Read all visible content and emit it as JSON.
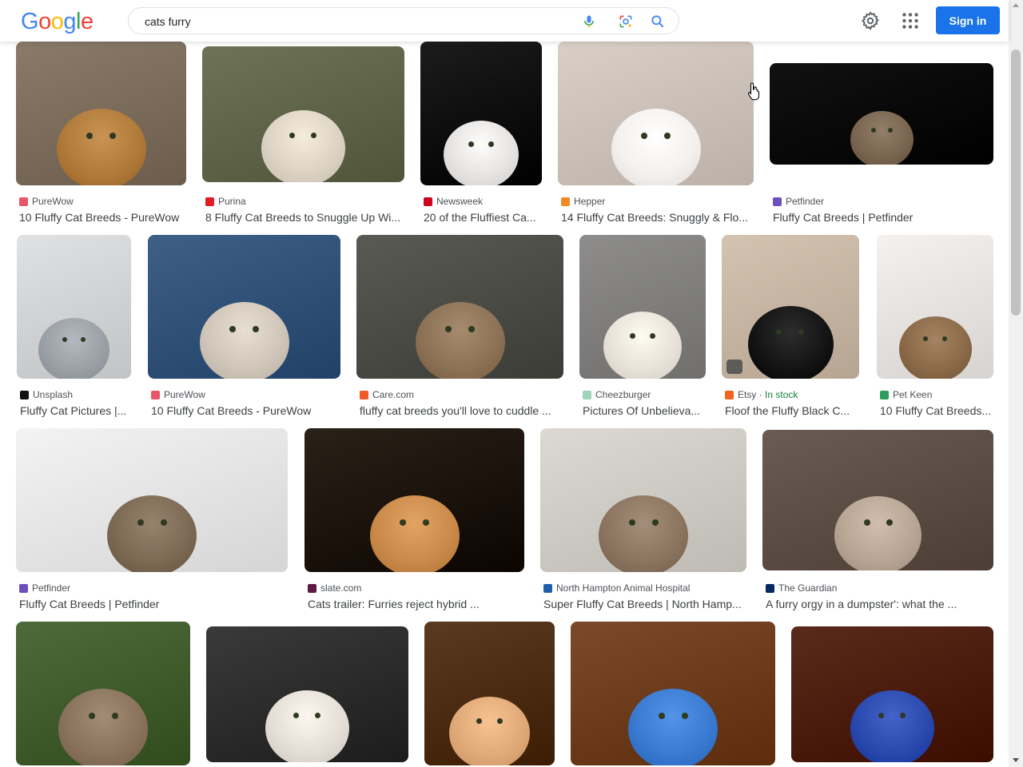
{
  "header": {
    "logo_letters": [
      {
        "ch": "G",
        "color": "#4285f4"
      },
      {
        "ch": "o",
        "color": "#ea4335"
      },
      {
        "ch": "o",
        "color": "#fbbc05"
      },
      {
        "ch": "g",
        "color": "#4285f4"
      },
      {
        "ch": "l",
        "color": "#34a853"
      },
      {
        "ch": "e",
        "color": "#ea4335"
      }
    ],
    "search_value": "cats furry",
    "signin_label": "Sign in",
    "icons": [
      "mic-icon",
      "lens-icon",
      "search-icon",
      "gear-icon",
      "apps-grid-icon"
    ]
  },
  "results": [
    {
      "source": "PureWow",
      "title": "10 Fluffy Cat Breeds - PureWow",
      "fav": "#e8566a",
      "bg": "#8a7a6a",
      "cat": "#b07a3a"
    },
    {
      "source": "Purina",
      "title": "8 Fluffy Cat Breeds to Snuggle Up Wi...",
      "fav": "#e31b23",
      "bg": "#6e7358",
      "cat": "#ddd3c4"
    },
    {
      "source": "Newsweek",
      "title": "20 of the Fluffiest Ca...",
      "fav": "#d0021b",
      "bg": "#1c1c1c",
      "cat": "#e6e4e2"
    },
    {
      "source": "Hepper",
      "title": "14 Fluffy Cat Breeds: Snuggly & Flo...",
      "fav": "#f08a24",
      "bg": "#d9cfc6",
      "cat": "#f4f1ee"
    },
    {
      "source": "Petfinder",
      "title": "Fluffy Cat Breeds | Petfinder",
      "fav": "#6b4fbb",
      "bg": "#111111",
      "cat": "#7a6650"
    },
    {
      "source": "Unsplash",
      "title": "Fluffy Cat Pictures |...",
      "fav": "#111111",
      "bg": "#dfe1e3",
      "cat": "#9aa0a6"
    },
    {
      "source": "PureWow",
      "title": "10 Fluffy Cat Breeds - PureWow",
      "fav": "#e8566a",
      "bg": "#3e5f86",
      "cat": "#cfc6b9"
    },
    {
      "source": "Care.com",
      "title": "fluffy cat breeds you'll love to cuddle ...",
      "fav": "#f05a28",
      "bg": "#5a5a55",
      "cat": "#8d7256"
    },
    {
      "source": "Cheezburger",
      "title": "Pictures Of Unbelieva...",
      "fav": "#9fd3b8",
      "bg": "#8e8d8b",
      "cat": "#e8e2d8"
    },
    {
      "source": "Etsy",
      "stock": "In stock",
      "title": "Floof the Fluffy Black C...",
      "fav": "#f1641e",
      "bg": "#d4c3b0",
      "cat": "#141414"
    },
    {
      "source": "Pet Keen",
      "title": "10 Fluffy Cat Breeds...",
      "fav": "#2a9d5c",
      "bg": "#f4f1ee",
      "cat": "#8a6a48"
    },
    {
      "source": "Petfinder",
      "title": "Fluffy Cat Breeds | Petfinder",
      "fav": "#6b4fbb",
      "bg": "#f3f3f3",
      "cat": "#7d6a55"
    },
    {
      "source": "slate.com",
      "title": "Cats trailer: Furries reject hybrid ...",
      "fav": "#5b1a3f",
      "bg": "#2a2218",
      "cat": "#c98a4a"
    },
    {
      "source": "North Hampton Animal Hospital",
      "title": "Super Fluffy Cat Breeds | North Hamp...",
      "fav": "#1f5fa8",
      "bg": "#dcd8d2",
      "cat": "#8b7560"
    },
    {
      "source": "The Guardian",
      "title": "A furry orgy in a dumpster': what the ...",
      "fav": "#052962",
      "bg": "#6a5c52",
      "cat": "#b8a593"
    },
    {
      "bg": "#4f6a3a",
      "cat": "#8a735c"
    },
    {
      "bg": "#3a3a3a",
      "cat": "#e4ded6"
    },
    {
      "bg": "#5a3a20",
      "cat": "#e0a978"
    },
    {
      "bg": "#7a4a2a",
      "cat": "#3a7ad0"
    },
    {
      "bg": "#5a2a1a",
      "cat": "#2a4ab0"
    }
  ]
}
